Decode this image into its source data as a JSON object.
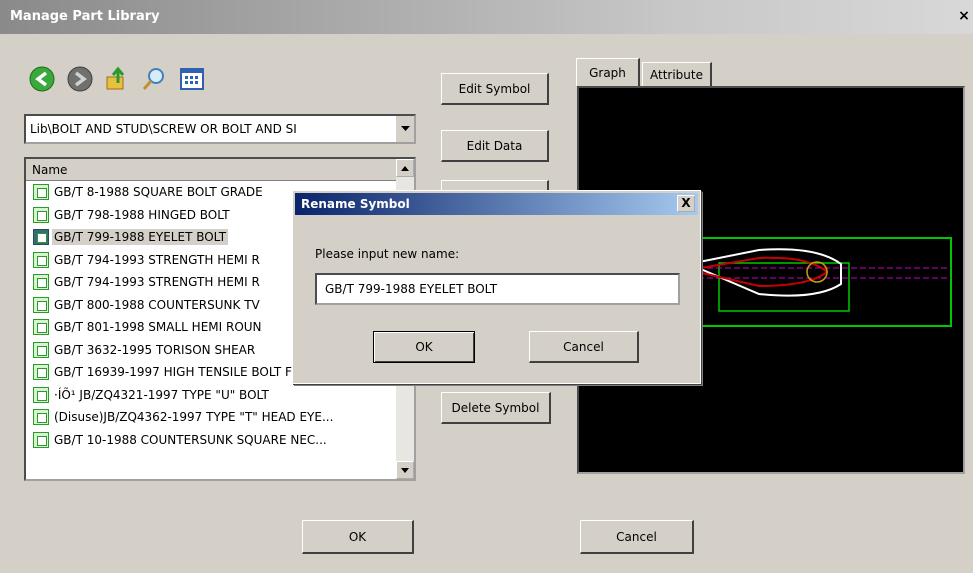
{
  "window": {
    "title": "Manage Part Library",
    "close_label": "×"
  },
  "toolbar": {
    "icons": [
      "back-icon",
      "forward-icon",
      "up-folder-icon",
      "search-icon",
      "view-icon"
    ]
  },
  "path": {
    "value": "Lib\\BOLT AND STUD\\SCREW OR BOLT AND SI"
  },
  "list": {
    "header": "Name",
    "items": [
      "GB/T 8-1988 SQUARE BOLT  GRADE",
      "GB/T 798-1988 HINGED BOLT",
      "GB/T 799-1988 EYELET BOLT",
      "GB/T 794-1993 STRENGTH HEMI R",
      "GB/T 794-1993 STRENGTH HEMI R",
      "GB/T 800-1988 COUNTERSUNK TV",
      "GB/T 801-1998 SMALL HEMI ROUN",
      "GB/T 3632-1995 TORISON SHEAR",
      "GB/T 16939-1997 HIGH TENSILE BOLT FOR ...",
      "·ÍÕ¹ JB/ZQ4321-1997 TYPE \"U\" BOLT",
      "(Disuse)JB/ZQ4362-1997 TYPE \"T\" HEAD EYE...",
      "GB/T 10-1988 COUNTERSUNK SQUARE NEC..."
    ],
    "selected_index": 2
  },
  "buttons": {
    "edit_symbol": "Edit Symbol",
    "edit_data": "Edit Data",
    "delete_symbol": "Delete Symbol",
    "ok": "OK",
    "cancel": "Cancel"
  },
  "tabs": {
    "graph": "Graph",
    "attribute": "Attribute"
  },
  "dialog": {
    "title": "Rename Symbol",
    "close_label": "X",
    "prompt": "Please input new name:",
    "value": "GB/T 799-1988 EYELET BOLT",
    "ok": "OK",
    "cancel": "Cancel"
  },
  "colors": {
    "graph_bg": "#000000",
    "outline_green": "#00c800",
    "eyelet_red": "#c80000",
    "centerline_magenta": "#c800c8"
  }
}
